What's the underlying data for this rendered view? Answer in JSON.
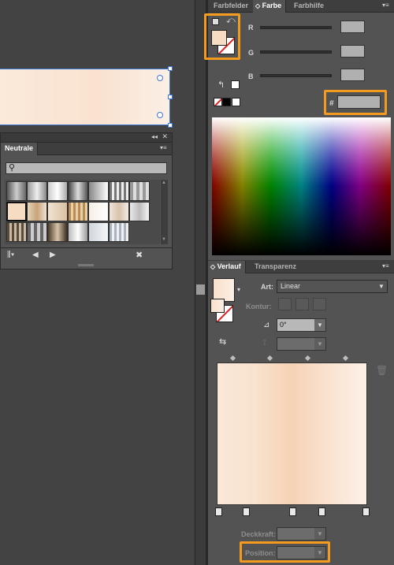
{
  "library_panel": {
    "tab": "Neutrale",
    "search_placeholder": ""
  },
  "color_panel": {
    "tabs": [
      "Farbfelder",
      "Farbe",
      "Farbhilfe"
    ],
    "active_tab": "Farbe",
    "channels": [
      "R",
      "G",
      "B"
    ],
    "hex_label": "#"
  },
  "gradient_panel": {
    "tabs": [
      "Verlauf",
      "Transparenz"
    ],
    "art_label": "Art:",
    "art_value": "Linear",
    "kontur_label": "Kontur:",
    "angle_value": "0°",
    "deckkraft_label": "Deckkraft:",
    "position_label": "Position:",
    "stops": [
      0,
      0.2,
      0.5,
      0.7,
      1.0
    ],
    "midpoints": [
      0.1,
      0.35,
      0.6,
      0.85
    ],
    "gradient_colors": [
      "#fbe6d4",
      "#f7d3b6",
      "#fdf0e6"
    ]
  },
  "colors": {
    "highlight": "#f39a1f",
    "selection": "#3c78d8"
  }
}
